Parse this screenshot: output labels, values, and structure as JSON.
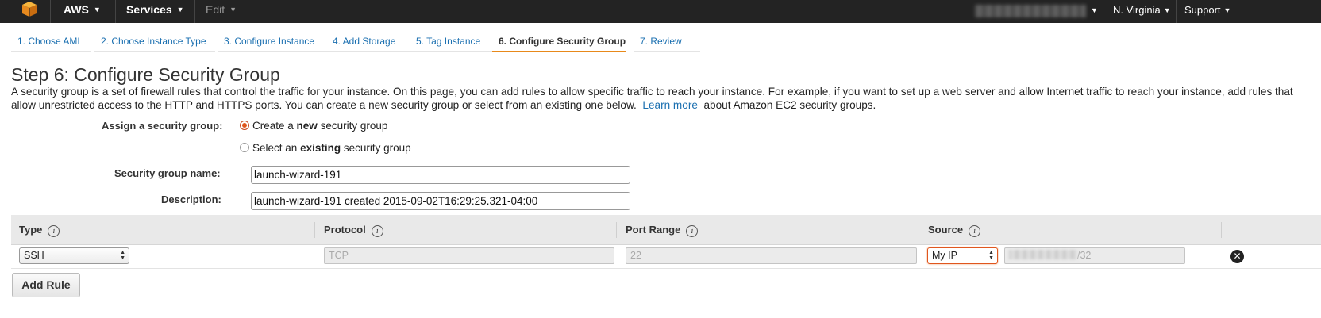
{
  "topnav": {
    "logo_icon": "aws-cube-icon",
    "aws_label": "AWS",
    "services_label": "Services",
    "edit_label": "Edit",
    "region_label": "N. Virginia",
    "support_label": "Support",
    "bg_color": "#232323",
    "logo_color": "#f29100"
  },
  "tabs": [
    {
      "label": "1. Choose AMI"
    },
    {
      "label": "2. Choose Instance Type"
    },
    {
      "label": "3. Configure Instance"
    },
    {
      "label": "4. Add Storage"
    },
    {
      "label": "5. Tag Instance"
    },
    {
      "label": "6. Configure Security Group"
    },
    {
      "label": "7. Review"
    }
  ],
  "active_tab_index": 5,
  "page": {
    "title": "Step 6: Configure Security Group",
    "intro_text": "A security group is a set of firewall rules that control the traffic for your instance. On this page, you can add rules to allow specific traffic to reach your instance. For example, if you want to set up a web server and allow Internet traffic to reach your instance, add rules that allow unrestricted access to the HTTP and HTTPS ports. You can create a new security group or select from an existing one below.",
    "learn_more": "Learn more",
    "intro_tail": "about Amazon EC2 security groups."
  },
  "form": {
    "assign_label": "Assign a security group:",
    "option_new_prefix": "Create a",
    "option_new_bold": "new",
    "option_new_suffix": "security group",
    "option_existing_prefix": "Select an",
    "option_existing_bold": "existing",
    "option_existing_suffix": "security group",
    "selected_option": "new",
    "name_label": "Security group name:",
    "name_value": "launch-wizard-191",
    "description_label": "Description:",
    "description_value": "launch-wizard-191 created 2015-09-02T16:29:25.321-04:00"
  },
  "rules_table": {
    "columns": [
      "Type",
      "Protocol",
      "Port Range",
      "Source"
    ],
    "rows": [
      {
        "type": "SSH",
        "protocol": "TCP",
        "port_range": "22",
        "source": "My IP",
        "cidr_suffix": "/32"
      }
    ],
    "add_rule_label": "Add Rule"
  },
  "colors": {
    "link": "#1a6fb0",
    "active_tab_underline": "#e8891a",
    "radio_selected": "#e0561e"
  }
}
